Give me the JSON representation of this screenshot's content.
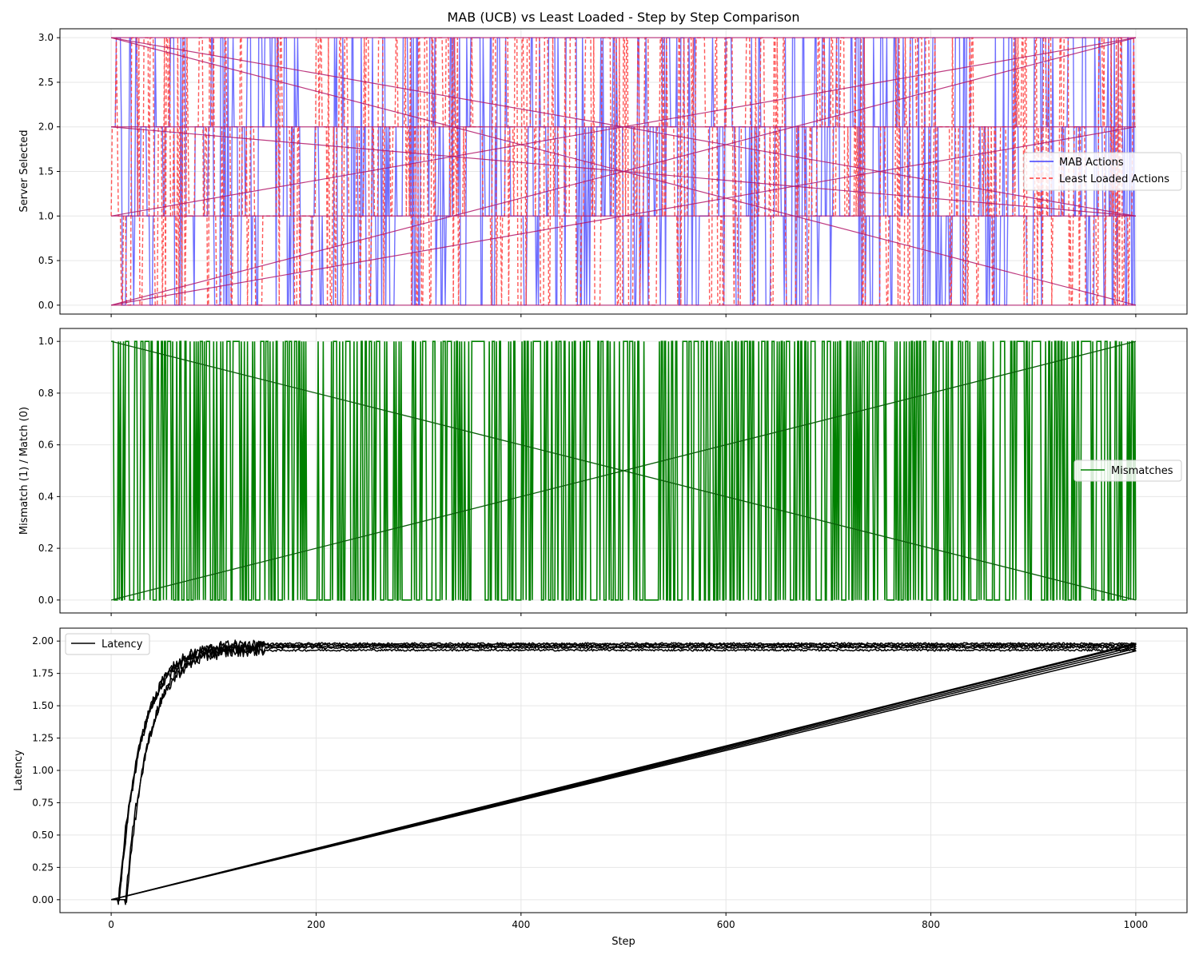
{
  "figure": {
    "title": "MAB (UCB) vs Least Loaded - Step by Step Comparison",
    "xlabel": "Step"
  },
  "colors": {
    "mab": "#3f3fff",
    "least_loaded": "#ff3b3b",
    "mismatch": "#008000",
    "latency": "#000000",
    "grid": "#e6e6e6"
  },
  "chart_data": [
    {
      "type": "line",
      "title": "MAB (UCB) vs Least Loaded - Step by Step Comparison",
      "xlabel": "",
      "ylabel": "Server Selected",
      "xlim": [
        -50,
        1050
      ],
      "ylim": [
        -0.1,
        3.1
      ],
      "xticks": [
        0,
        200,
        400,
        600,
        800,
        1000
      ],
      "yticks": [
        0.0,
        0.5,
        1.0,
        1.5,
        2.0,
        2.5,
        3.0
      ],
      "ytick_labels": [
        "0.0",
        "0.5",
        "1.0",
        "1.5",
        "2.0",
        "2.5",
        "3.0"
      ],
      "grid": true,
      "legend_position": "center-right",
      "series": [
        {
          "name": "MAB Actions",
          "style": "solid",
          "values_description_levels": [
            0,
            1,
            2,
            3
          ]
        },
        {
          "name": "Least Loaded Actions",
          "style": "dashed",
          "values_description_levels": [
            0,
            1,
            2,
            3
          ]
        }
      ],
      "wrap_segments": [
        {
          "from": [
            1000,
            3
          ],
          "to": [
            0,
            1
          ]
        },
        {
          "from": [
            1000,
            2
          ],
          "to": [
            0,
            0
          ]
        },
        {
          "from": [
            1000,
            1
          ],
          "to": [
            0,
            3
          ]
        },
        {
          "from": [
            1000,
            0
          ],
          "to": [
            0,
            3
          ]
        },
        {
          "from": [
            1000,
            1
          ],
          "to": [
            0,
            2
          ]
        },
        {
          "from": [
            1000,
            3
          ],
          "to": [
            0,
            0
          ]
        }
      ]
    },
    {
      "type": "line",
      "xlabel": "",
      "ylabel": "Mismatch (1) / Match (0)",
      "xlim": [
        -50,
        1050
      ],
      "ylim": [
        -0.05,
        1.05
      ],
      "xticks": [
        0,
        200,
        400,
        600,
        800,
        1000
      ],
      "yticks": [
        0.0,
        0.2,
        0.4,
        0.6,
        0.8,
        1.0
      ],
      "ytick_labels": [
        "0.0",
        "0.2",
        "0.4",
        "0.6",
        "0.8",
        "1.0"
      ],
      "grid": true,
      "legend_position": "center-right",
      "series": [
        {
          "name": "Mismatches",
          "values_description_levels": [
            0,
            1
          ]
        }
      ],
      "wrap_segments": [
        {
          "from": [
            1000,
            0
          ],
          "to": [
            0,
            1
          ]
        },
        {
          "from": [
            1000,
            1
          ],
          "to": [
            0,
            0
          ]
        }
      ]
    },
    {
      "type": "line",
      "xlabel": "Step",
      "ylabel": "Latency",
      "xlim": [
        -50,
        1050
      ],
      "ylim": [
        -0.1,
        2.1
      ],
      "xticks": [
        0,
        200,
        400,
        600,
        800,
        1000
      ],
      "xtick_labels": [
        "0",
        "200",
        "400",
        "600",
        "800",
        "1000"
      ],
      "yticks": [
        0.0,
        0.25,
        0.5,
        0.75,
        1.0,
        1.25,
        1.5,
        1.75,
        2.0
      ],
      "ytick_labels": [
        "0.00",
        "0.25",
        "0.50",
        "0.75",
        "1.00",
        "1.25",
        "1.50",
        "1.75",
        "2.00"
      ],
      "grid": true,
      "legend_position": "upper-left",
      "series": [
        {
          "name": "Latency",
          "runs": 5,
          "plateau_values": [
            1.93,
            1.95,
            1.96,
            1.97,
            1.98
          ],
          "end_value": 1.93
        }
      ]
    }
  ]
}
